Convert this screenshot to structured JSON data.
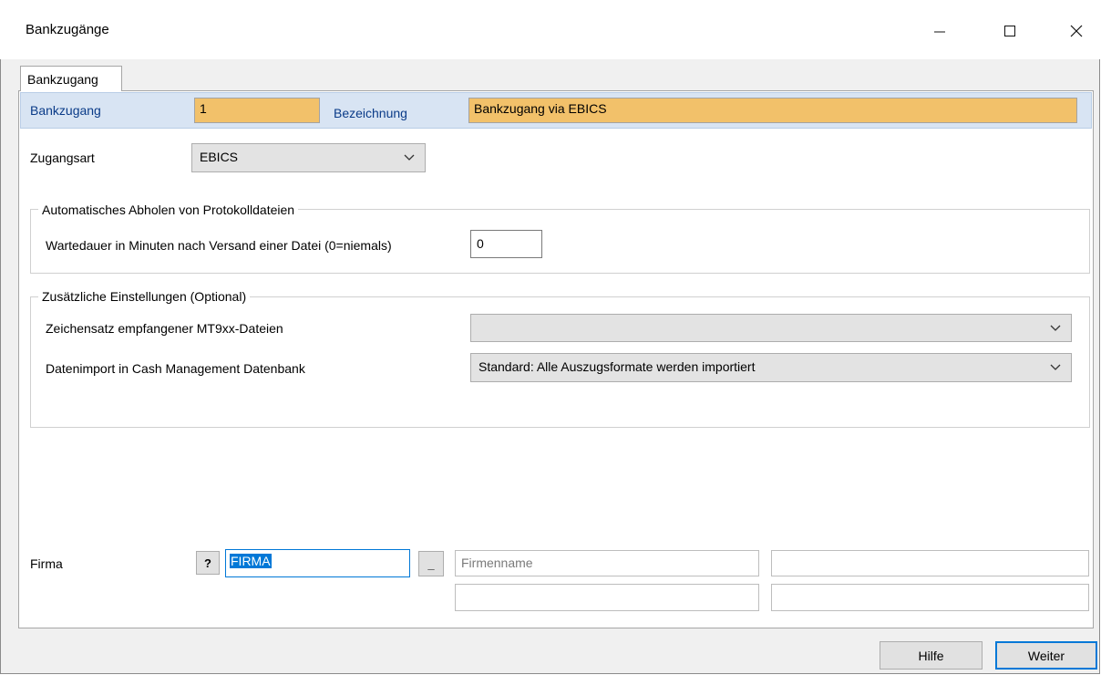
{
  "window": {
    "title": "Bankzugänge",
    "minimize_glyph": "—",
    "maximize_glyph": "☐",
    "close_glyph": "✕"
  },
  "tab": {
    "label": "Bankzugang"
  },
  "header": {
    "bankzugang_label": "Bankzugang",
    "bankzugang_value": "1",
    "bezeichnung_label": "Bezeichnung",
    "bezeichnung_value": "Bankzugang via EBICS"
  },
  "zugangsart": {
    "label": "Zugangsart",
    "value": "EBICS"
  },
  "group_auto": {
    "title": "Automatisches Abholen von Protokolldateien",
    "wartedauer_label": "Wartedauer in Minuten nach Versand einer Datei (0=niemals)",
    "wartedauer_value": "0"
  },
  "group_extra": {
    "title": "Zusätzliche Einstellungen (Optional)",
    "zeichensatz_label": "Zeichensatz empfangener MT9xx-Dateien",
    "zeichensatz_value": "",
    "datenimport_label": "Datenimport in Cash Management Datenbank",
    "datenimport_value": "Standard: Alle Auszugsformate werden importiert"
  },
  "firma": {
    "label": "Firma",
    "help_button": "?",
    "value": "FIRMA",
    "lookup_button": "_",
    "firmenname_placeholder": "Firmenname"
  },
  "footer": {
    "hilfe": "Hilfe",
    "weiter": "Weiter"
  },
  "colors": {
    "highlight_orange": "#f2c16a",
    "header_blue": "#d8e4f3",
    "label_blue": "#0a3b88",
    "focus_blue": "#0078d7"
  }
}
